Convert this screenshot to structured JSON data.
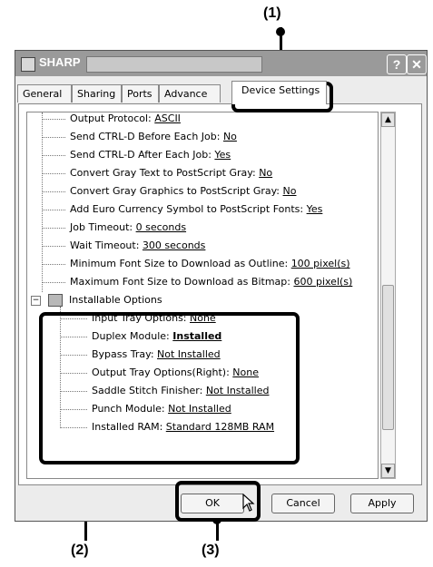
{
  "callouts": {
    "c1": "(1)",
    "c2": "(2)",
    "c3": "(3)"
  },
  "window": {
    "title": "SHARP",
    "help_glyph": "?",
    "close_glyph": "✕"
  },
  "tabs": [
    "General",
    "Sharing",
    "Ports",
    "Advance",
    "Device Settings"
  ],
  "tree": {
    "settings": [
      {
        "label": "Output Protocol: ",
        "value": "ASCII"
      },
      {
        "label": "Send CTRL-D Before Each Job: ",
        "value": "No"
      },
      {
        "label": "Send CTRL-D After Each Job: ",
        "value": "Yes"
      },
      {
        "label": "Convert Gray Text to PostScript Gray: ",
        "value": "No"
      },
      {
        "label": "Convert Gray Graphics to PostScript Gray: ",
        "value": "No"
      },
      {
        "label": "Add Euro Currency Symbol to PostScript Fonts: ",
        "value": "Yes"
      },
      {
        "label": "Job Timeout: ",
        "value": "0 seconds"
      },
      {
        "label": "Wait Timeout: ",
        "value": "300 seconds"
      },
      {
        "label": "Minimum Font Size to Download as Outline: ",
        "value": "100 pixel(s)"
      },
      {
        "label": "Maximum Font Size to Download as Bitmap: ",
        "value": "600 pixel(s)"
      }
    ],
    "group_label": "Installable Options",
    "group_toggle": "−",
    "options": [
      {
        "label": "Input Tray Options: ",
        "value": "None"
      },
      {
        "label": "Duplex Module: ",
        "value": "Installed"
      },
      {
        "label": "Bypass Tray: ",
        "value": "Not Installed"
      },
      {
        "label": "Output Tray Options(Right): ",
        "value": "None"
      },
      {
        "label": "Saddle Stitch Finisher: ",
        "value": "Not Installed"
      },
      {
        "label": "Punch Module: ",
        "value": "Not Installed"
      },
      {
        "label": "Installed RAM: ",
        "value": "Standard 128MB RAM"
      }
    ]
  },
  "scroll": {
    "up": "▲",
    "down": "▼"
  },
  "buttons": {
    "ok": "OK",
    "cancel": "Cancel",
    "apply": "Apply"
  }
}
